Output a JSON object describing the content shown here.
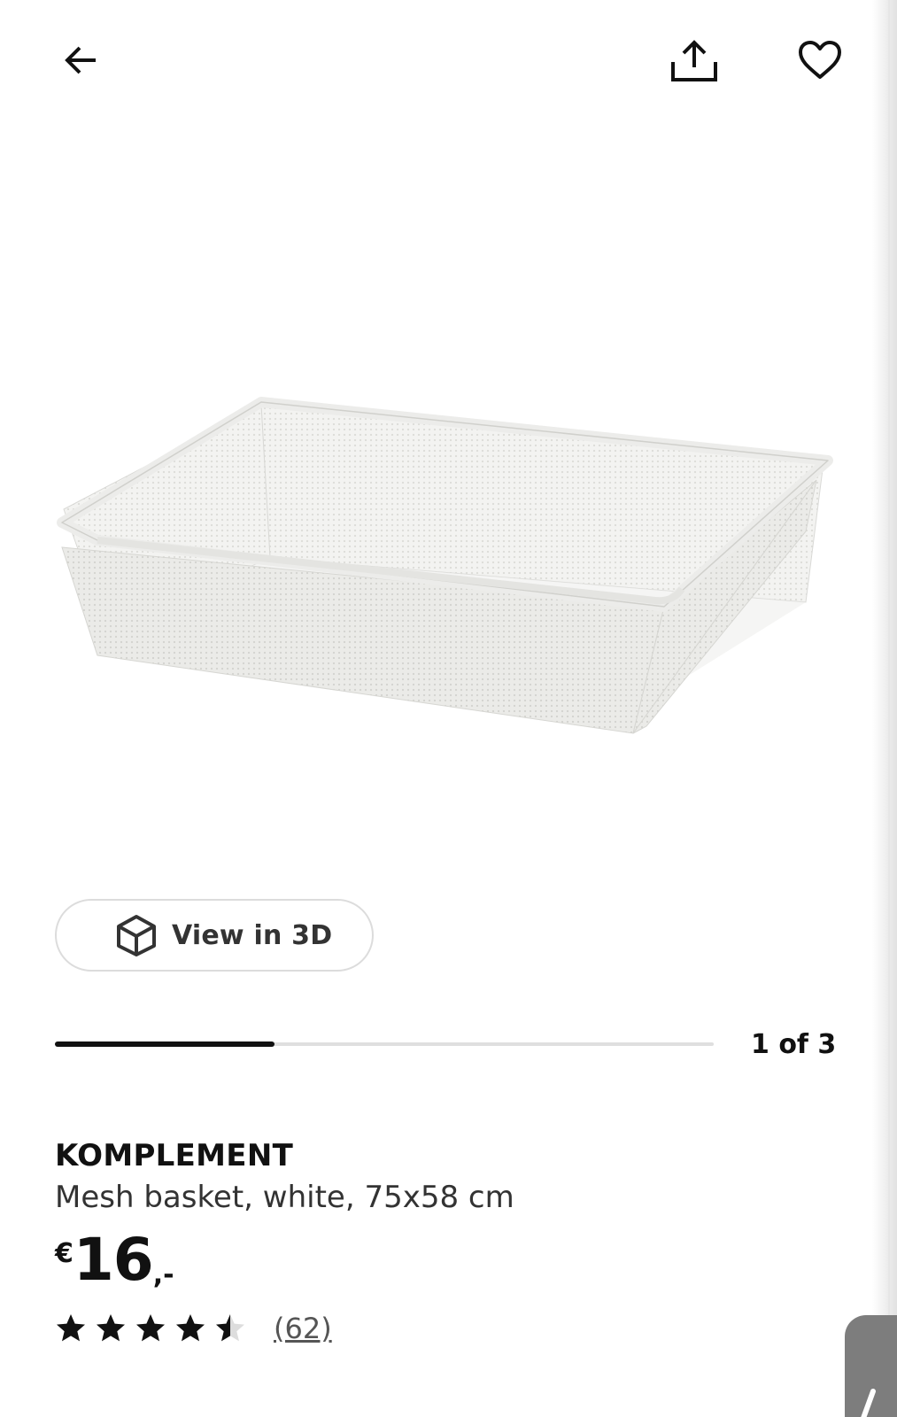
{
  "top_bar": {
    "back_icon": "arrow-left-icon",
    "share_icon": "share-upload-icon",
    "favorite_icon": "heart-outline-icon"
  },
  "gallery": {
    "image_icon": "mesh-basket-product-image",
    "view_3d_label": "View in 3D",
    "view_3d_icon": "cube-3d-icon",
    "current": 1,
    "total": 3,
    "indicator_text": "1 of 3"
  },
  "product": {
    "brand": "KOMPLEMENT",
    "description": "Mesh basket, white, 75x58 cm",
    "price": {
      "currency": "€",
      "amount": "16",
      "suffix": ",-"
    },
    "rating": {
      "value": 4.5,
      "max": 5,
      "review_count": "(62)"
    }
  },
  "colors": {
    "text": "#111111",
    "secondary_text": "#333333",
    "track": "#dfdfdf",
    "progress": "#111111",
    "float_tab": "#7d7d7d"
  }
}
